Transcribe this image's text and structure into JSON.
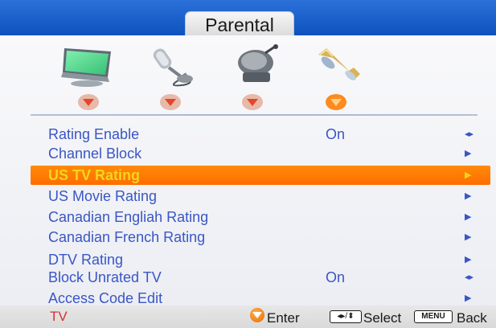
{
  "window": {
    "title": "Parental"
  },
  "icons": [
    {
      "name": "picture-icon"
    },
    {
      "name": "audio-icon"
    },
    {
      "name": "setup-icon"
    },
    {
      "name": "parental-icon"
    }
  ],
  "menu": {
    "items": [
      {
        "label": "Rating Enable",
        "value": "On",
        "indicator": "◂▸"
      },
      {
        "label": "Channel Block",
        "value": "",
        "indicator": "▶"
      },
      {
        "label": "US TV Rating",
        "value": "",
        "indicator": "▶",
        "selected": true
      },
      {
        "label": "US Movie Rating",
        "value": "",
        "indicator": "▶"
      },
      {
        "label": "Canadian Engliah Rating",
        "value": "",
        "indicator": "▶"
      },
      {
        "label": "Canadian French Rating",
        "value": "",
        "indicator": "▶"
      },
      {
        "label": "DTV Rating",
        "value": "",
        "indicator": "▶"
      },
      {
        "label": "Block Unrated TV",
        "value": "On",
        "indicator": "◂▸"
      },
      {
        "label": "Access Code Edit",
        "value": "",
        "indicator": "▶"
      }
    ]
  },
  "footer": {
    "source": "TV",
    "enter_label": "Enter",
    "select_key": "◂▸/⬍",
    "select_label": "Select",
    "menu_key": "MENU",
    "back_label": "Back"
  },
  "colors": {
    "frame": "#0a49b6",
    "panel": "#f1f2f6",
    "text": "#3a56c4",
    "selected_text": "#f2d61a",
    "highlight": "#ff7400",
    "source_text": "#d8302a"
  }
}
